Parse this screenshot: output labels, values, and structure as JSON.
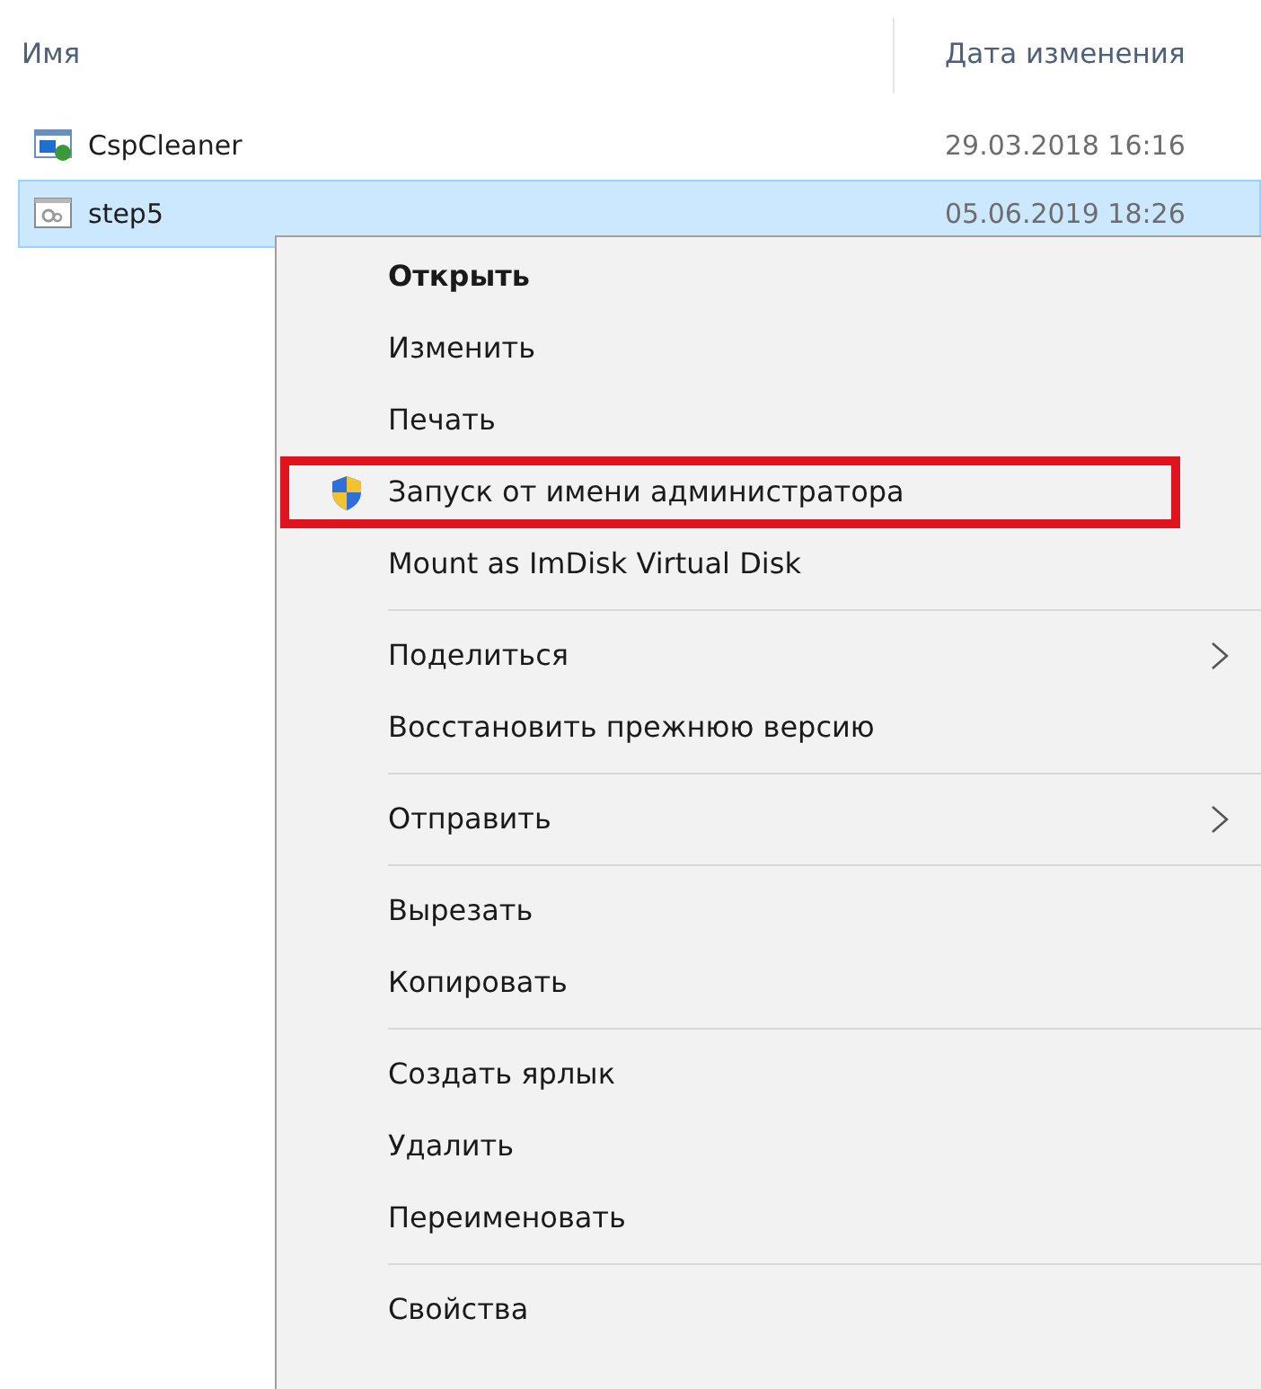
{
  "columns": [
    {
      "label": "Имя"
    },
    {
      "label": "Дата изменения"
    }
  ],
  "files": [
    {
      "name": "CspCleaner",
      "modified": "29.03.2018 16:16",
      "selected": false,
      "kind": "app"
    },
    {
      "name": "step5",
      "modified": "05.06.2019 18:26",
      "selected": true,
      "kind": "config"
    }
  ],
  "context_menu": [
    {
      "kind": "item",
      "label": "Открыть",
      "default": true,
      "submenu": false,
      "highlighted": false
    },
    {
      "kind": "item",
      "label": "Изменить",
      "default": false,
      "submenu": false,
      "highlighted": false
    },
    {
      "kind": "item",
      "label": "Печать",
      "default": false,
      "submenu": false,
      "highlighted": false
    },
    {
      "kind": "elevated_item",
      "label": "Запуск от имени администратора",
      "default": false,
      "submenu": false,
      "highlighted": true
    },
    {
      "kind": "item",
      "label": "Mount as ImDisk Virtual Disk",
      "default": false,
      "submenu": false,
      "highlighted": false
    },
    {
      "kind": "separator"
    },
    {
      "kind": "item",
      "label": "Поделиться",
      "default": false,
      "submenu": true,
      "highlighted": false
    },
    {
      "kind": "item",
      "label": "Восстановить прежнюю версию",
      "default": false,
      "submenu": false,
      "highlighted": false
    },
    {
      "kind": "separator"
    },
    {
      "kind": "item",
      "label": "Отправить",
      "default": false,
      "submenu": true,
      "highlighted": false
    },
    {
      "kind": "separator"
    },
    {
      "kind": "item",
      "label": "Вырезать",
      "default": false,
      "submenu": false,
      "highlighted": false
    },
    {
      "kind": "item",
      "label": "Копировать",
      "default": false,
      "submenu": false,
      "highlighted": false
    },
    {
      "kind": "separator"
    },
    {
      "kind": "item",
      "label": "Создать ярлык",
      "default": false,
      "submenu": false,
      "highlighted": false
    },
    {
      "kind": "item",
      "label": "Удалить",
      "default": false,
      "submenu": false,
      "highlighted": false
    },
    {
      "kind": "item",
      "label": "Переименовать",
      "default": false,
      "submenu": false,
      "highlighted": false
    },
    {
      "kind": "separator"
    },
    {
      "kind": "item",
      "label": "Свойства",
      "default": false,
      "submenu": false,
      "highlighted": false
    }
  ]
}
